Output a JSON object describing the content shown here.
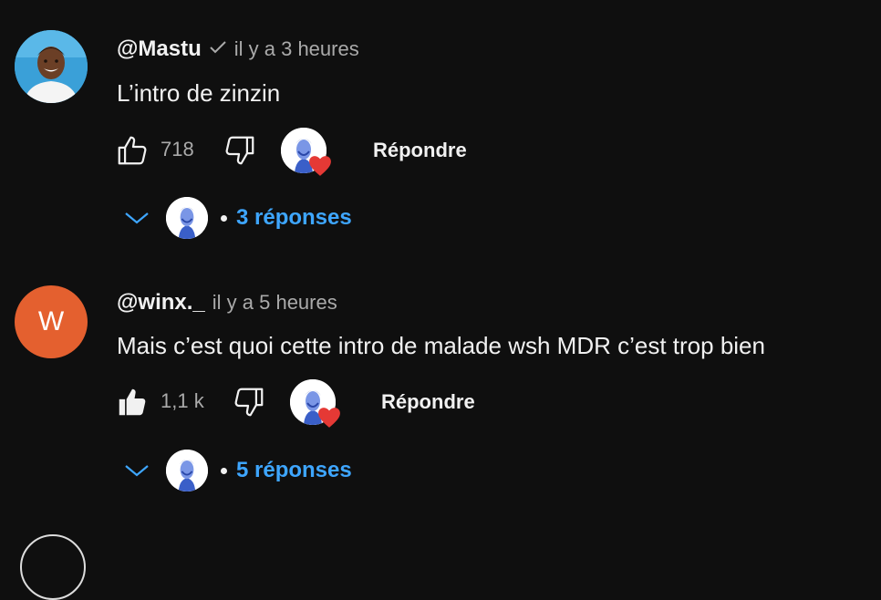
{
  "comments": [
    {
      "author": "@Mastu",
      "verified": true,
      "time": "il y a 3 heures",
      "text": "L’intro de zinzin",
      "likes": "718",
      "liked": false,
      "reply_label": "Répondre",
      "replies_label": "3 réponses"
    },
    {
      "author": "@winx._",
      "avatar_letter": "W",
      "avatar_color": "#e4602f",
      "verified": false,
      "time": "il y a 5 heures",
      "text": "Mais c’est quoi cette intro de malade wsh MDR c’est trop bien",
      "likes": "1,1 k",
      "liked": true,
      "reply_label": "Répondre",
      "replies_label": "5 réponses"
    }
  ],
  "colors": {
    "background": "#0f0f0f",
    "link": "#3ea6ff",
    "heart": "#e53935",
    "muted": "#aaaaaa"
  }
}
